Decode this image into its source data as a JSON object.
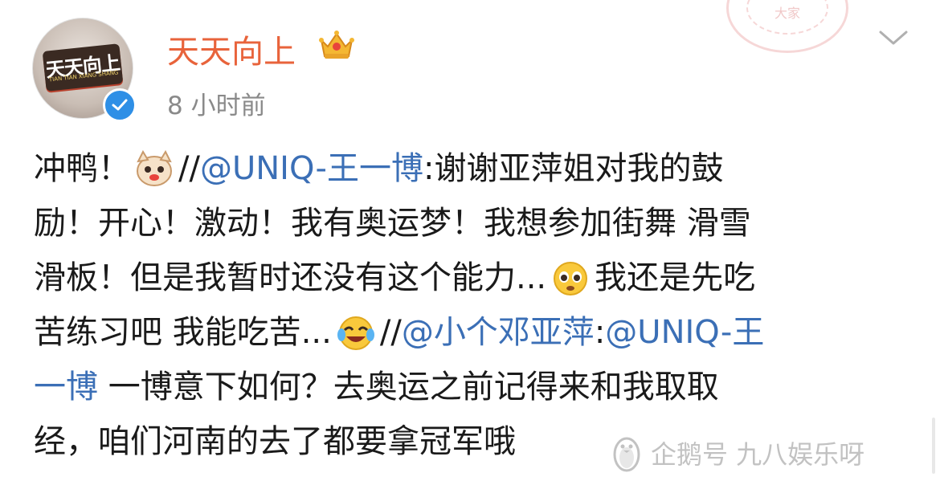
{
  "post": {
    "username": "天天向上",
    "timestamp": "8 小时前",
    "avatar_logo_text": "天天向上",
    "avatar_logo_sub": "TIAN TIAN XIANG SHANG",
    "stamp_text": "大家",
    "colors": {
      "username": "#e8633b",
      "mention": "#3b6fb6",
      "verified": "#2e8fe6",
      "text": "#1a1a1a",
      "timestamp": "#8a8a8a"
    },
    "icons": [
      "crown-icon",
      "verified-icon",
      "chevron-down-icon",
      "emoji-doge-icon",
      "emoji-pleading-icon",
      "emoji-laugh-cry-icon",
      "penguin-icon"
    ],
    "body": {
      "l1_a": "冲鸭！",
      "l1_b": "//",
      "l1_mention": "@UNIQ-王一博",
      "l1_c": ":谢谢亚萍姐对我的鼓",
      "l2": "励！开心！激动！我有奥运梦！我想参加街舞 滑雪",
      "l3_a": "滑板！但是我暂时还没有这个能力...",
      "l3_b": "我还是先吃",
      "l4_a": "苦练习吧 我能吃苦...",
      "l4_b": "//",
      "l4_mention1": "@小个邓亚萍",
      "l4_c": ":",
      "l4_mention2": "@UNIQ-王",
      "l5_mention": "一博",
      "l5_a": " 一博意下如何？去奥运之前记得来和我取取",
      "l6": "经，咱们河南的去了都要拿冠军哦"
    }
  },
  "watermark": {
    "text": "企鹅号 九八娱乐呀"
  }
}
